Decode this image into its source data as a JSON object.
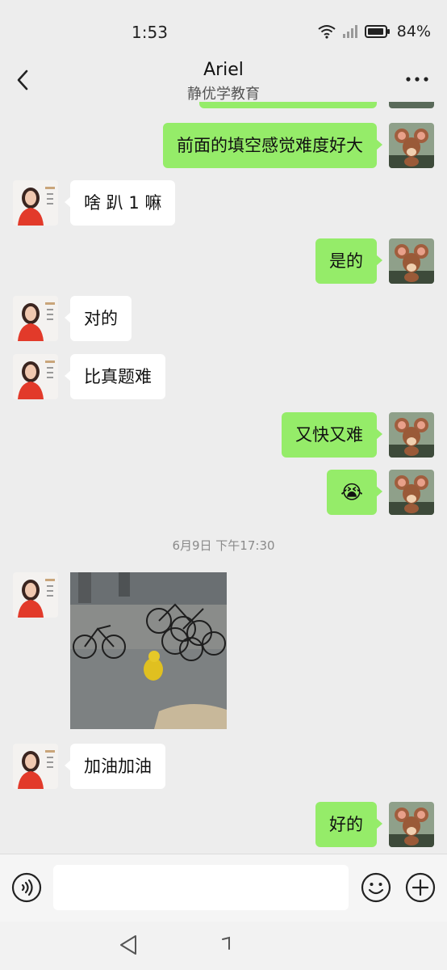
{
  "status_bar": {
    "time": "1:53",
    "battery": "84%"
  },
  "header": {
    "title": "Ariel",
    "subtitle": "静优学教育"
  },
  "messages": [
    {
      "side": "out",
      "text": "前面的填空感觉难度好大"
    },
    {
      "side": "in",
      "text": "啥 趴 1 嘛"
    },
    {
      "side": "out",
      "text": "是的"
    },
    {
      "side": "in",
      "text": "对的"
    },
    {
      "side": "in",
      "text": "比真题难"
    },
    {
      "side": "out",
      "text": "又快又难"
    },
    {
      "side": "out",
      "text": "😭"
    },
    {
      "side": "in",
      "text": "加油加油"
    },
    {
      "side": "out",
      "text": "好的"
    }
  ],
  "timestamp": "6月9日 下午17:30",
  "input": {
    "placeholder": ""
  },
  "icons": {
    "back": "back-chevron-icon",
    "more": "more-dots-icon",
    "voice": "voice-icon",
    "emoji": "emoji-icon",
    "plus": "plus-icon",
    "nav_back": "nav-back-icon",
    "nav_home": "nav-home-icon"
  },
  "colors": {
    "background": "#ededed",
    "outgoing_bubble": "#95ec69",
    "incoming_bubble": "#ffffff"
  }
}
